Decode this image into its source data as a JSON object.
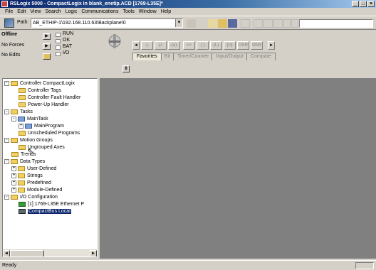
{
  "window": {
    "title": "RSLogix 5000 - CompactLogix in blank_enetip.ACD [1769-L35E]*",
    "controls": [
      "_",
      "□",
      "×"
    ]
  },
  "menu": [
    "File",
    "Edit",
    "View",
    "Search",
    "Logic",
    "Communications",
    "Tools",
    "Window",
    "Help"
  ],
  "pathbar": {
    "label": "Path:",
    "value": "AB_ETHIP-1\\192.168.110.63\\Backplane\\0",
    "dropdown": "▼",
    "search_value": ""
  },
  "status": {
    "mode": "Offline",
    "forces": "No Forces",
    "edits": "No Edits",
    "leds": [
      "RUN",
      "OK",
      "BAT",
      "I/O"
    ],
    "btn_arrow": "▶",
    "key_button": "8"
  },
  "instruction_tabs": [
    "Favorites",
    "Bit",
    "Timer/Counter",
    "Input/Output",
    "Compare"
  ],
  "instruction_buttons": [
    "◄",
    "-|-",
    "-|/-",
    "-(u)-",
    "<>",
    "-( )-",
    "-(L)-",
    "-(U)-",
    "OSR",
    "ONS",
    "►"
  ],
  "tree": [
    {
      "label": "Controller CompactLogix",
      "icon": "folder",
      "exp": "-"
    },
    {
      "label": "Controller Tags",
      "icon": "folder",
      "exp": ""
    },
    {
      "label": "Controller Fault Handler",
      "icon": "folder",
      "exp": ""
    },
    {
      "label": "Power-Up Handler",
      "icon": "folder",
      "exp": ""
    },
    {
      "label": "Tasks",
      "icon": "folder",
      "exp": "-"
    },
    {
      "label": "MainTask",
      "icon": "task",
      "exp": "-"
    },
    {
      "label": "MainProgram",
      "icon": "program",
      "exp": "+"
    },
    {
      "label": "Unscheduled Programs",
      "icon": "folder",
      "exp": ""
    },
    {
      "label": "Motion Groups",
      "icon": "folder",
      "exp": "-"
    },
    {
      "label": "Ungrouped Axes",
      "icon": "folder",
      "exp": ""
    },
    {
      "label": "Trends",
      "icon": "folder",
      "exp": ""
    },
    {
      "label": "Data Types",
      "icon": "folder",
      "exp": "-"
    },
    {
      "label": "User-Defined",
      "icon": "datatype",
      "exp": "+"
    },
    {
      "label": "Strings",
      "icon": "datatype",
      "exp": "+"
    },
    {
      "label": "Predefined",
      "icon": "datatype",
      "exp": "+"
    },
    {
      "label": "Module-Defined",
      "icon": "datatype",
      "exp": "+"
    },
    {
      "label": "I/O Configuration",
      "icon": "folder",
      "exp": "-"
    },
    {
      "label": "[1] 1769-L35E Ethernet P",
      "icon": "module",
      "exp": ""
    },
    {
      "label": "CompactBus Local",
      "icon": "bus",
      "exp": "",
      "selected": true
    }
  ],
  "statusbar": {
    "text": "Ready"
  },
  "colors": {
    "titlebar": "#0a246a",
    "workspace": "#808080",
    "face": "#d4d0c8",
    "selection": "#0a246a"
  }
}
